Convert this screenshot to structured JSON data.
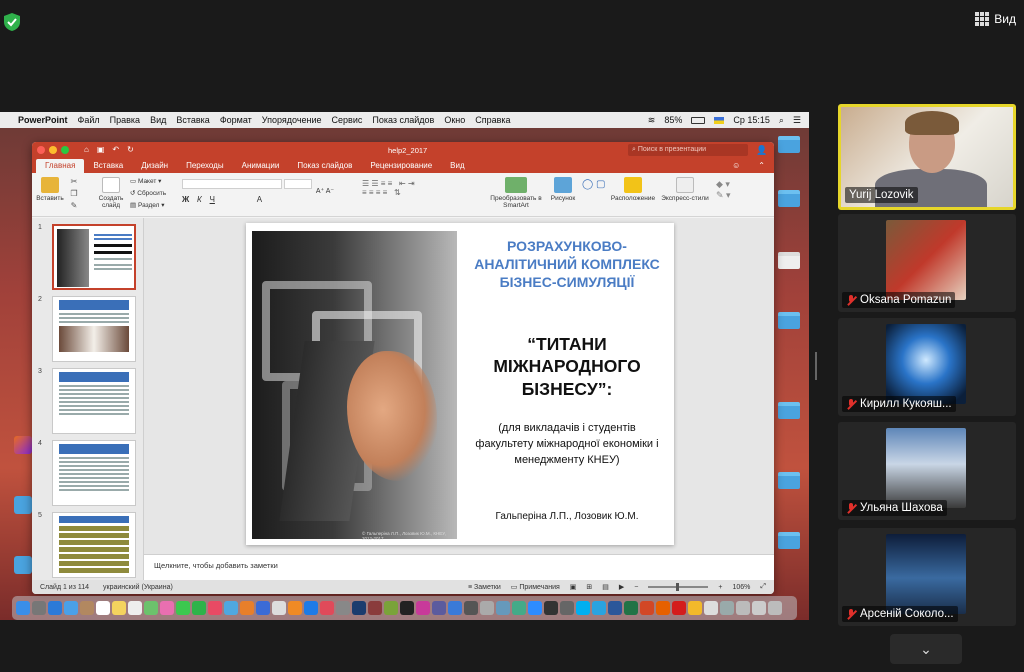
{
  "zoom": {
    "view_label": "Вид",
    "more_label": "⌄"
  },
  "mac": {
    "apple": "",
    "app": "PowerPoint",
    "menus": [
      "Файл",
      "Правка",
      "Вид",
      "Вставка",
      "Формат",
      "Упорядочение",
      "Сервис",
      "Показ слайдов",
      "Окно",
      "Справка"
    ],
    "battery": "85%",
    "clock": "Ср 15:15"
  },
  "ppt": {
    "doc_name": "help2_2017",
    "search_placeholder": "Поиск в презентации",
    "tabs": [
      "Главная",
      "Вставка",
      "Дизайн",
      "Переходы",
      "Анимации",
      "Показ слайдов",
      "Рецензирование",
      "Вид"
    ],
    "ribbon": {
      "paste": "Вставить",
      "new_slide": "Создать слайд",
      "layout": "Макет",
      "reset": "Сбросить",
      "section": "Раздел",
      "smartart": "Преобразовать в SmartArt",
      "picture": "Рисунок",
      "arrange": "Расположение",
      "quick_styles": "Экспресс-стили"
    },
    "slide": {
      "heading": "РОЗРАХУНКОВО-АНАЛІТИЧНИЙ КОМПЛЕКС БІЗНЕС-СИМУЛЯЦІЇ",
      "title": "“ТИТАНИ МІЖНАРОДНОГО БІЗНЕСУ”:",
      "subtitle": "(для викладачів і студентів факультету міжнародної економіки і менеджменту КНЕУ)",
      "authors": "Гальперіна Л.П., Лозовик Ю.М.",
      "photo_caption": "© Гальперіна Л.П., Лозовик Ю.М., КНЕУ, 2012-2017"
    },
    "notes_placeholder": "Щелкните, чтобы добавить заметки",
    "status": {
      "slide_of": "Слайд 1 из 114",
      "language": "украинский (Украина)",
      "notes": "Заметки",
      "comments": "Примечания",
      "zoom": "106%"
    }
  },
  "participants": [
    {
      "name": "Yurij Lozovik",
      "muted": false,
      "active": true
    },
    {
      "name": "Oksana Pomazun",
      "muted": true,
      "active": false
    },
    {
      "name": "Кирилл Кукояш...",
      "muted": true,
      "active": false
    },
    {
      "name": "Ульяна Шахова",
      "muted": true,
      "active": false
    },
    {
      "name": "Арсеній Соколо...",
      "muted": true,
      "active": false
    }
  ],
  "colors": {
    "ppt_accent": "#c4412b",
    "slide_heading": "#4a7cc4",
    "active_speaker": "#e6d62a",
    "mute": "#e0302b"
  }
}
